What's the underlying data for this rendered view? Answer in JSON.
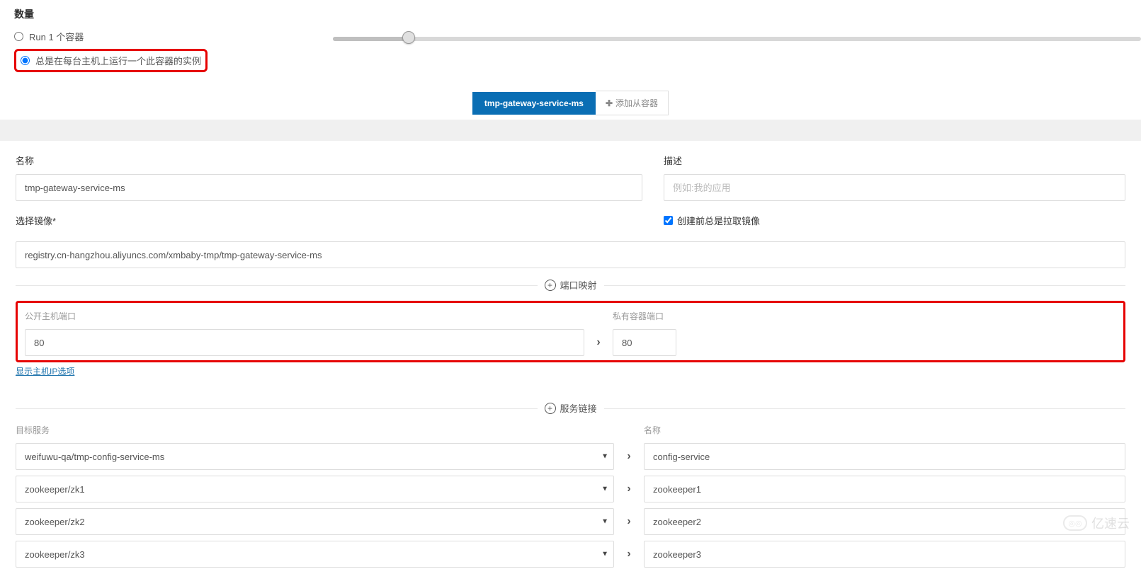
{
  "quantity": {
    "heading": "数量",
    "option_run1": "Run 1 个容器",
    "option_always": "总是在每台主机上运行一个此容器的实例"
  },
  "tabs": {
    "active": "tmp-gateway-service-ms",
    "add": "添加从容器"
  },
  "name_section": {
    "label": "名称",
    "value": "tmp-gateway-service-ms"
  },
  "desc_section": {
    "label": "描述",
    "placeholder": "例如:我的应用"
  },
  "image_section": {
    "label": "选择镜像*",
    "value": "registry.cn-hangzhou.aliyuncs.com/xmbaby-tmp/tmp-gateway-service-ms",
    "pull_checkbox": "创建前总是拉取镜像"
  },
  "port_section": {
    "divider": "端口映射",
    "host_label": "公开主机端口",
    "container_label": "私有容器端口",
    "host_value": "80",
    "container_value": "80",
    "show_ip_link": "显示主机IP选项"
  },
  "svc_section": {
    "divider": "服务链接",
    "target_label": "目标服务",
    "name_label": "名称",
    "rows": [
      {
        "target": "weifuwu-qa/tmp-config-service-ms",
        "name": "config-service"
      },
      {
        "target": "zookeeper/zk1",
        "name": "zookeeper1"
      },
      {
        "target": "zookeeper/zk2",
        "name": "zookeeper2"
      },
      {
        "target": "zookeeper/zk3",
        "name": "zookeeper3"
      }
    ]
  },
  "watermark": "亿速云"
}
